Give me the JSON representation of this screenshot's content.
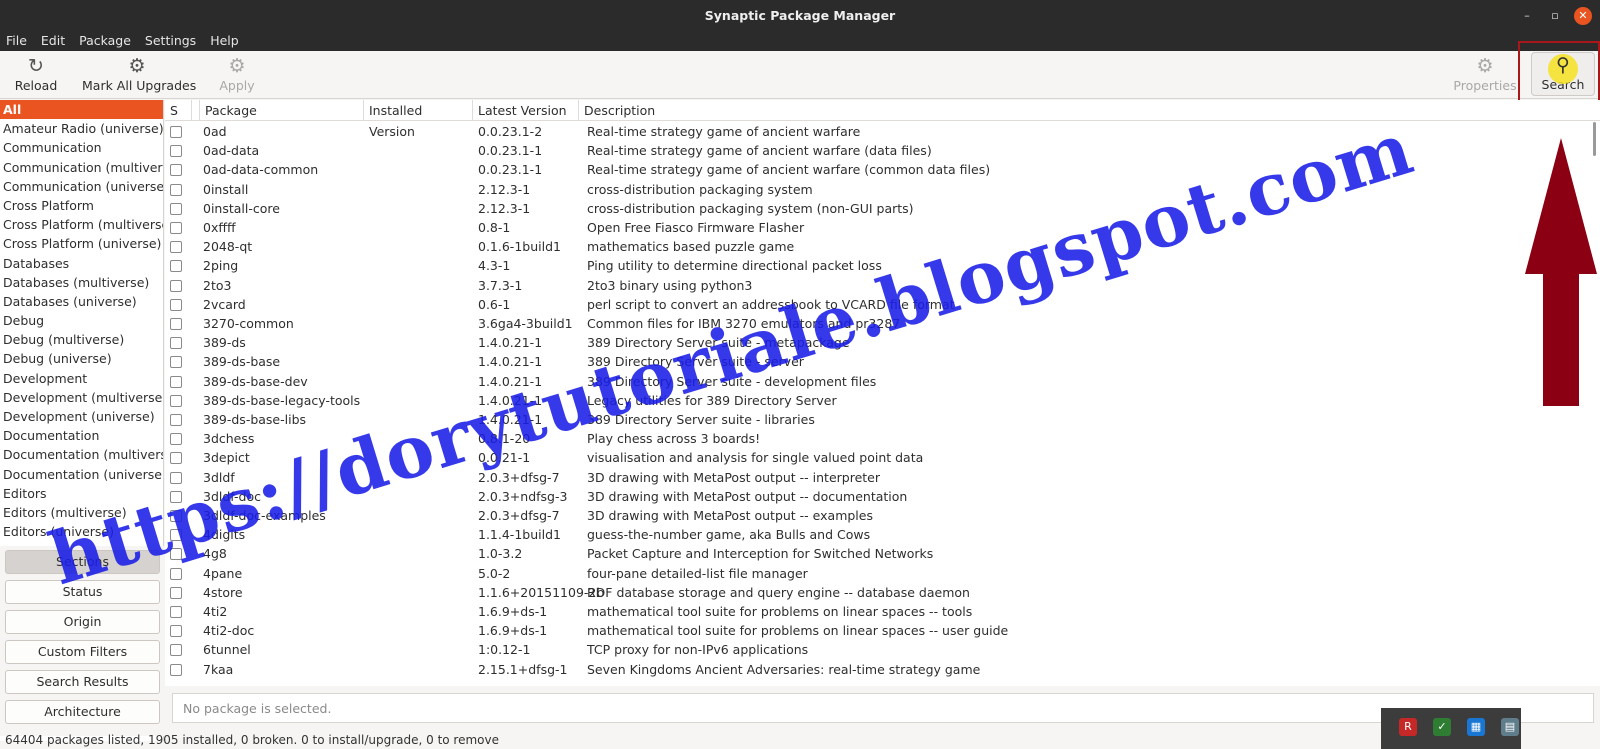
{
  "window": {
    "title": "Synaptic Package Manager"
  },
  "menu": [
    "File",
    "Edit",
    "Package",
    "Settings",
    "Help"
  ],
  "toolbar": {
    "reload": "Reload",
    "mark_all": "Mark All Upgrades",
    "apply": "Apply",
    "properties": "Properties",
    "search": "Search"
  },
  "sidebar": {
    "categories": [
      "All",
      "Amateur Radio (universe)",
      "Communication",
      "Communication (multiverse)",
      "Communication (universe)",
      "Cross Platform",
      "Cross Platform (multiverse)",
      "Cross Platform (universe)",
      "Databases",
      "Databases (multiverse)",
      "Databases (universe)",
      "Debug",
      "Debug (multiverse)",
      "Debug (universe)",
      "Development",
      "Development (multiverse)",
      "Development (universe)",
      "Documentation",
      "Documentation (multiverse)",
      "Documentation (universe)",
      "Editors",
      "Editors (multiverse)",
      "Editors (universe)"
    ],
    "buttons": [
      "Sections",
      "Status",
      "Origin",
      "Custom Filters",
      "Search Results",
      "Architecture"
    ]
  },
  "table": {
    "headers": [
      "S",
      "Package",
      "Installed Version",
      "Latest Version",
      "Description"
    ],
    "rows": [
      [
        "0ad",
        "0.0.23.1-2",
        "Real-time strategy game of ancient warfare"
      ],
      [
        "0ad-data",
        "0.0.23.1-1",
        "Real-time strategy game of ancient warfare (data files)"
      ],
      [
        "0ad-data-common",
        "0.0.23.1-1",
        "Real-time strategy game of ancient warfare (common data files)"
      ],
      [
        "0install",
        "2.12.3-1",
        "cross-distribution packaging system"
      ],
      [
        "0install-core",
        "2.12.3-1",
        "cross-distribution packaging system (non-GUI parts)"
      ],
      [
        "0xffff",
        "0.8-1",
        "Open Free Fiasco Firmware Flasher"
      ],
      [
        "2048-qt",
        "0.1.6-1build1",
        "mathematics based puzzle game"
      ],
      [
        "2ping",
        "4.3-1",
        "Ping utility to determine directional packet loss"
      ],
      [
        "2to3",
        "3.7.3-1",
        "2to3 binary using python3"
      ],
      [
        "2vcard",
        "0.6-1",
        "perl script to convert an addressbook to VCARD file format"
      ],
      [
        "3270-common",
        "3.6ga4-3build1",
        "Common files for IBM 3270 emulators and pr3287"
      ],
      [
        "389-ds",
        "1.4.0.21-1",
        "389 Directory Server suite - metapackage"
      ],
      [
        "389-ds-base",
        "1.4.0.21-1",
        "389 Directory Server suite - server"
      ],
      [
        "389-ds-base-dev",
        "1.4.0.21-1",
        "389 Directory Server suite - development files"
      ],
      [
        "389-ds-base-legacy-tools",
        "1.4.0.21-1",
        "Legacy utilities for 389 Directory Server"
      ],
      [
        "389-ds-base-libs",
        "1.4.0.21-1",
        "389 Directory Server suite - libraries"
      ],
      [
        "3dchess",
        "0.8.1-20",
        "Play chess across 3 boards!"
      ],
      [
        "3depict",
        "0.0.21-1",
        "visualisation and analysis for single valued point data"
      ],
      [
        "3dldf",
        "2.0.3+dfsg-7",
        "3D drawing with MetaPost output -- interpreter"
      ],
      [
        "3dldf-doc",
        "2.0.3+ndfsg-3",
        "3D drawing with MetaPost output -- documentation"
      ],
      [
        "3dldf-doc-examples",
        "2.0.3+dfsg-7",
        "3D drawing with MetaPost output -- examples"
      ],
      [
        "4digits",
        "1.1.4-1build1",
        "guess-the-number game, aka Bulls and Cows"
      ],
      [
        "4g8",
        "1.0-3.2",
        "Packet Capture and Interception for Switched Networks"
      ],
      [
        "4pane",
        "5.0-2",
        "four-pane detailed-list file manager"
      ],
      [
        "4store",
        "1.1.6+20151109-2b",
        "RDF database storage and query engine -- database daemon"
      ],
      [
        "4ti2",
        "1.6.9+ds-1",
        "mathematical tool suite for problems on linear spaces -- tools"
      ],
      [
        "4ti2-doc",
        "1.6.9+ds-1",
        "mathematical tool suite for problems on linear spaces -- user guide"
      ],
      [
        "6tunnel",
        "1:0.12-1",
        "TCP proxy for non-IPv6 applications"
      ],
      [
        "7kaa",
        "2.15.1+dfsg-1",
        "Seven Kingdoms Ancient Adversaries: real-time strategy game"
      ]
    ]
  },
  "details": {
    "empty": "No package is selected."
  },
  "status": "64404 packages listed, 1905 installed, 0 broken. 0 to install/upgrade, 0 to remove",
  "watermark": "https://dorytutoriale.blogspot.com",
  "colors": {
    "accent": "#e95420",
    "annotation_red": "#a8181b",
    "watermark_blue": "#1a1ee6"
  }
}
